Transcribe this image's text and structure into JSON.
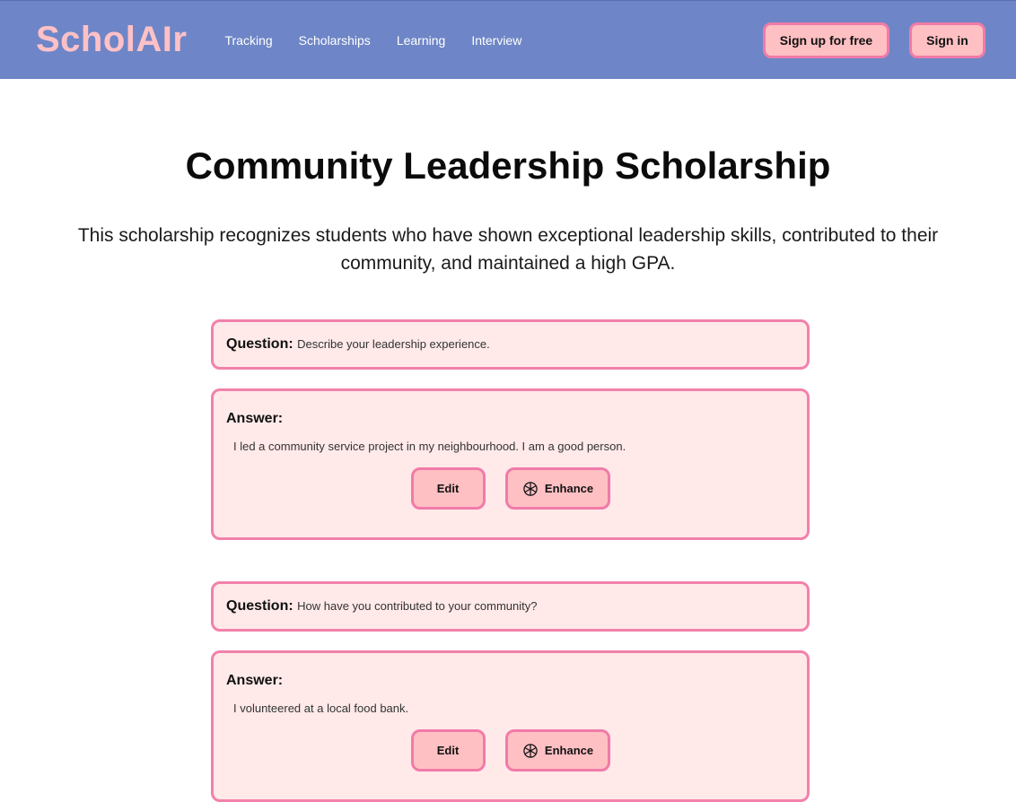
{
  "nav": {
    "logo_main": "Schol",
    "logo_ai": "AIr",
    "links": [
      "Tracking",
      "Scholarships",
      "Learning",
      "Interview"
    ],
    "signup_label": "Sign up for free",
    "signin_label": "Sign in"
  },
  "page": {
    "title": "Community Leadership Scholarship",
    "description": "This scholarship recognizes students who have shown exceptional leadership skills, contributed to their community, and maintained a high GPA."
  },
  "qa": [
    {
      "question_label": "Question:",
      "question": "Describe your leadership experience.",
      "answer_label": "Answer:",
      "answer": "I led a community service project in my neighbourhood. I am a good person.",
      "edit_label": "Edit",
      "enhance_label": "Enhance"
    },
    {
      "question_label": "Question:",
      "question": "How have you contributed to your community?",
      "answer_label": "Answer:",
      "answer": "I volunteered at a local food bank.",
      "edit_label": "Edit",
      "enhance_label": "Enhance"
    }
  ],
  "colors": {
    "navbar": "#6e86c7",
    "logo": "#ffc1c6",
    "card_bg": "#ffe9e9",
    "card_border": "#f281ab",
    "button_bg": "#ffc0c3"
  },
  "icons": {
    "enhance": "openai-knot-icon"
  }
}
